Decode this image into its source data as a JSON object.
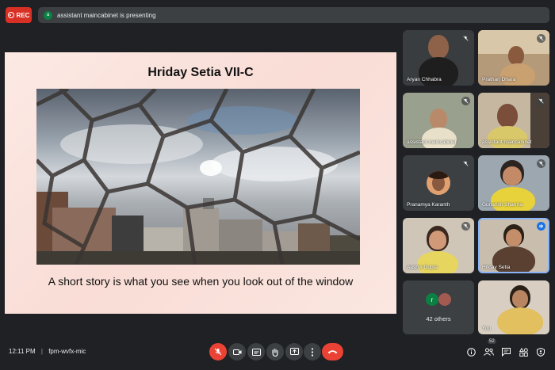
{
  "recording": {
    "label": "REC"
  },
  "presenting_bar": {
    "avatar_initial": "a",
    "text": "assistant maincabinet is presenting"
  },
  "slide": {
    "title": "Hriday Setia VII-C",
    "caption": "A short story is what you see when you look out of the window"
  },
  "participants": [
    {
      "name": "Aryan Chhabra"
    },
    {
      "name": "Prathan Dhara"
    },
    {
      "name": "assistant maincabinet"
    },
    {
      "name": "assistant maincabinet"
    },
    {
      "name": "Pranamya Karanth"
    },
    {
      "name": "Gunansh Sharma"
    },
    {
      "name": "Aashvi Gupta"
    },
    {
      "name": "Hriday Setia"
    },
    {
      "name": "You"
    }
  ],
  "others_tile": {
    "label": "42 others",
    "avatar_initial": "r"
  },
  "bottom_bar": {
    "time": "12:11 PM",
    "separator": "|",
    "meeting_code": "fpm-wvfx-mic",
    "people_count": "52"
  },
  "colors": {
    "rec": "#d93025",
    "end_call": "#ea4335",
    "active_speaker": "#8ab4f8",
    "bg": "#202124"
  }
}
